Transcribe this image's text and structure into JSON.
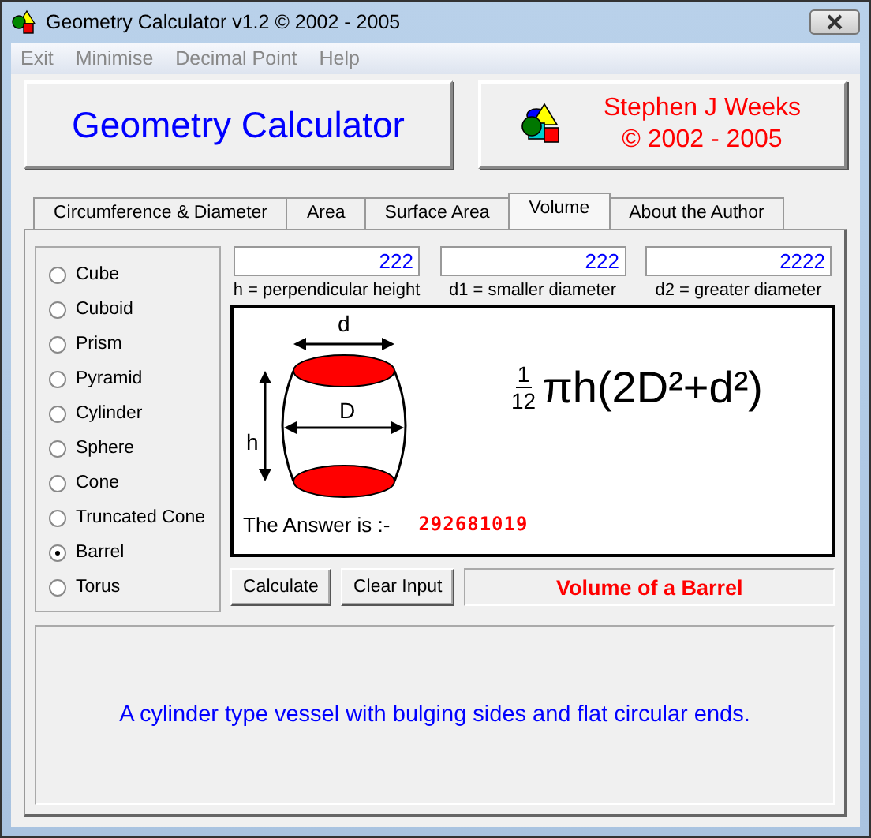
{
  "window": {
    "title": "Geometry Calculator v1.2 ©  2002 - 2005"
  },
  "menu": [
    "Exit",
    "Minimise",
    "Decimal Point",
    "Help"
  ],
  "header": {
    "title": "Geometry Calculator",
    "author": "Stephen J Weeks",
    "copyright": "© 2002 - 2005"
  },
  "tabs": [
    {
      "label": "Circumference & Diameter",
      "selected": false
    },
    {
      "label": "Area",
      "selected": false
    },
    {
      "label": "Surface Area",
      "selected": false
    },
    {
      "label": "Volume",
      "selected": true
    },
    {
      "label": "About the Author",
      "selected": false
    }
  ],
  "shapes": [
    {
      "label": "Cube",
      "selected": false
    },
    {
      "label": "Cuboid",
      "selected": false
    },
    {
      "label": "Prism",
      "selected": false
    },
    {
      "label": "Pyramid",
      "selected": false
    },
    {
      "label": "Cylinder",
      "selected": false
    },
    {
      "label": "Sphere",
      "selected": false
    },
    {
      "label": "Cone",
      "selected": false
    },
    {
      "label": "Truncated Cone",
      "selected": false
    },
    {
      "label": "Barrel",
      "selected": true
    },
    {
      "label": "Torus",
      "selected": false
    }
  ],
  "inputs": [
    {
      "value": "222",
      "caption": "h = perpendicular height"
    },
    {
      "value": "222",
      "caption": "d1 = smaller diameter"
    },
    {
      "value": "2222",
      "caption": "d2 = greater diameter"
    }
  ],
  "diagram": {
    "labels": {
      "top": "d",
      "middle": "D",
      "side": "h"
    }
  },
  "formula": {
    "numerator": "1",
    "denominator": "12",
    "expression": "πh(2D²+d²)"
  },
  "answer": {
    "label": "The Answer is :-",
    "value": "292681019"
  },
  "buttons": [
    "Calculate",
    "Clear Input"
  ],
  "result_title": "Volume of a Barrel",
  "description": "A cylinder type vessel with bulging sides and flat circular ends."
}
